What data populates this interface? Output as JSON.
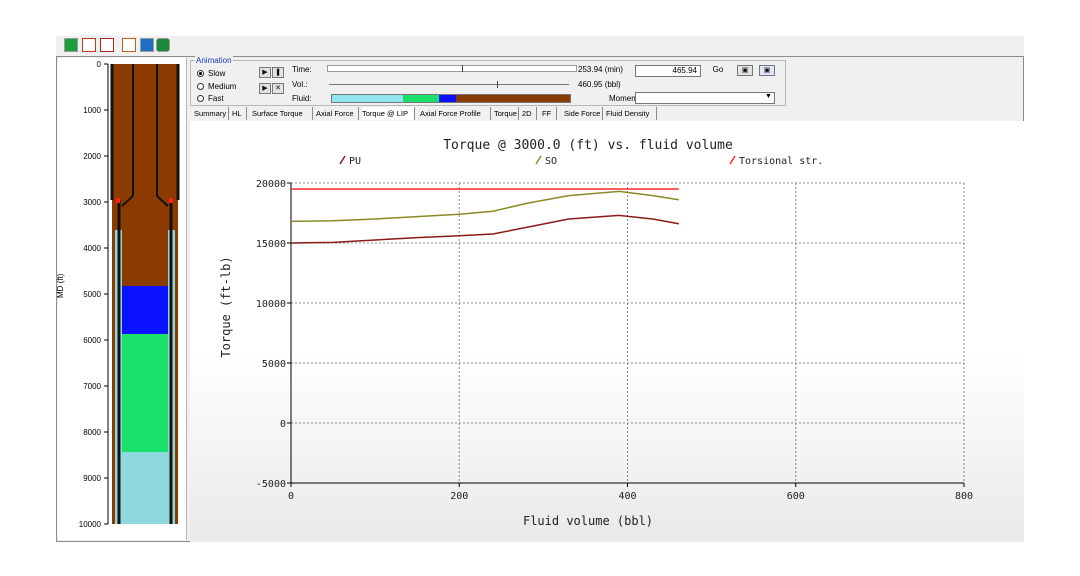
{
  "toolbar": {
    "buttons": [
      "back-icon",
      "report-icon",
      "graph-icon",
      "units-icon",
      "screen-icon",
      "export-icon"
    ]
  },
  "well_panel": {
    "axis_label": "MD (ft)",
    "depth_ticks": [
      "0",
      "1000",
      "2000",
      "3000",
      "4000",
      "5000",
      "6000",
      "7000",
      "8000",
      "9000",
      "10000"
    ],
    "colors": {
      "mud": "#8b3a00",
      "annulus_fluid": "#8fd8de",
      "spacer": "#0a12ff",
      "cement": "#19e06a",
      "pipe": "#111111",
      "marker": "#ff2020"
    }
  },
  "animation": {
    "group_label": "Animation",
    "speeds": [
      {
        "label": "Slow",
        "selected": true
      },
      {
        "label": "Medium",
        "selected": false
      },
      {
        "label": "Fast",
        "selected": false
      }
    ],
    "time_label": "Time:",
    "time_value": "253.94 (min)",
    "vol_label": "Vol.:",
    "vol_value": "460.95 (bbl)",
    "fluid_label": "Fluid:",
    "fluid_colors": [
      "#8fe6ee",
      "#19e06a",
      "#0a12ff",
      "#8b3a00"
    ],
    "goto_value": "465.94",
    "go_label": "Go",
    "moment_label": "Moment:",
    "moment_value": ""
  },
  "tabs": [
    {
      "label": "Summary",
      "active": false
    },
    {
      "label": "HL",
      "active": false
    },
    {
      "label": "Surface Torque",
      "active": false
    },
    {
      "label": "Axial Force",
      "active": false
    },
    {
      "label": "Torque @ LIP",
      "active": true
    },
    {
      "label": "Axial Force Profile",
      "active": false
    },
    {
      "label": "Torque",
      "active": false
    },
    {
      "label": "2D",
      "active": false
    },
    {
      "label": "FF",
      "active": false
    },
    {
      "label": "Side Force",
      "active": false
    },
    {
      "label": "Fluid Density",
      "active": false
    }
  ],
  "chart_data": {
    "type": "line",
    "title": "Torque @ 3000.0 (ft) vs. fluid volume",
    "xlabel": "Fluid volume (bbl)",
    "ylabel": "Torque (ft-lb)",
    "xlim": [
      0,
      800
    ],
    "ylim": [
      -5000,
      20000
    ],
    "xticks": [
      0,
      200,
      400,
      600,
      800
    ],
    "yticks": [
      20000,
      15000,
      10000,
      5000,
      0,
      -5000
    ],
    "grid": true,
    "legend": "top",
    "series": [
      {
        "name": "PU",
        "color": "#8b1a1a",
        "x": [
          0,
          50,
          100,
          150,
          200,
          240,
          280,
          330,
          390,
          430,
          461
        ],
        "y": [
          15000,
          15050,
          15250,
          15450,
          15600,
          15750,
          16300,
          17000,
          17300,
          17000,
          16600
        ]
      },
      {
        "name": "SO",
        "color": "#8a8a25",
        "x": [
          0,
          50,
          100,
          150,
          200,
          240,
          280,
          330,
          390,
          430,
          461
        ],
        "y": [
          16800,
          16850,
          17000,
          17200,
          17400,
          17650,
          18300,
          18950,
          19300,
          18950,
          18600
        ]
      },
      {
        "name": "Torsional str.",
        "color": "#ff2a2a",
        "x": [
          0,
          461
        ],
        "y": [
          19500,
          19500
        ]
      }
    ]
  }
}
